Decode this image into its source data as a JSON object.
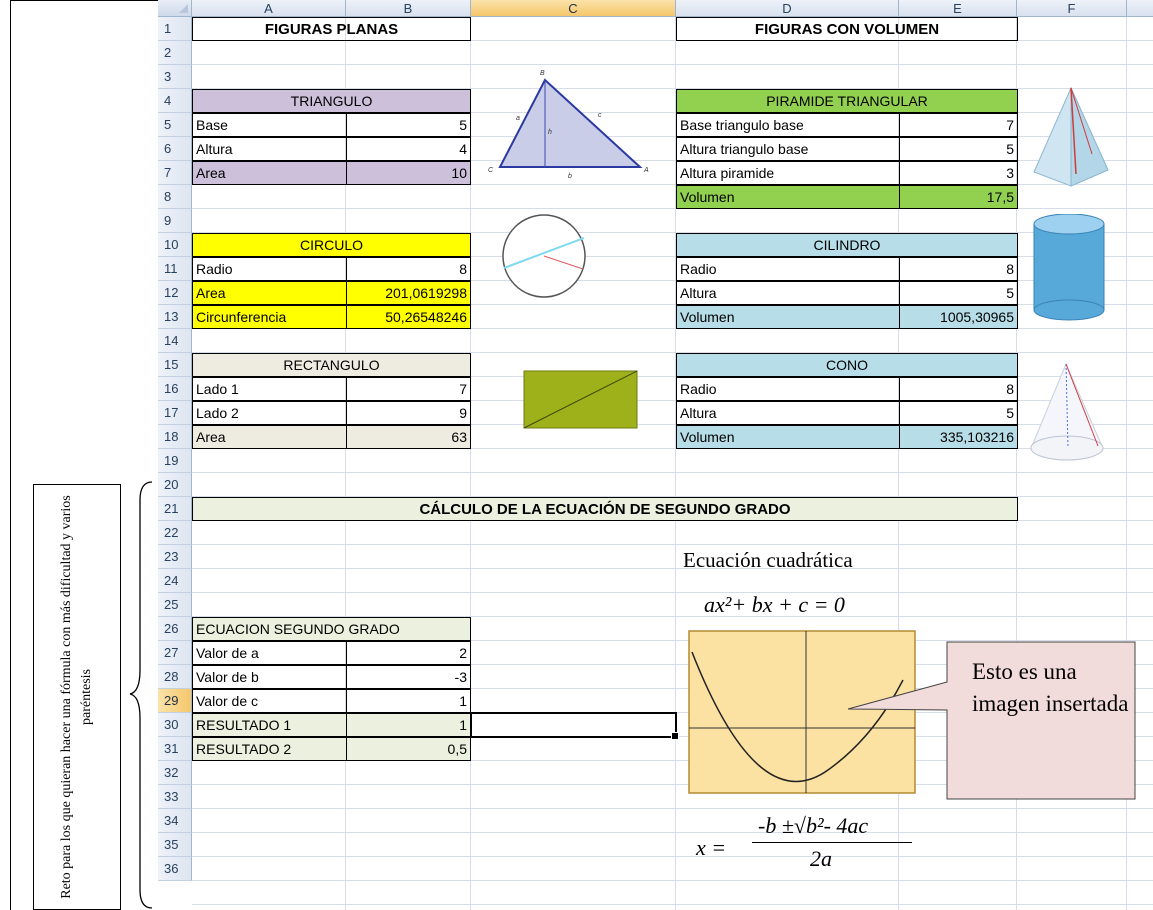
{
  "columns": [
    "A",
    "B",
    "C",
    "D",
    "E",
    "F"
  ],
  "rows": [
    "1",
    "2",
    "3",
    "4",
    "5",
    "6",
    "7",
    "8",
    "9",
    "10",
    "11",
    "12",
    "13",
    "14",
    "15",
    "16",
    "17",
    "18",
    "19",
    "20",
    "21",
    "22",
    "23",
    "24",
    "25",
    "26",
    "27",
    "28",
    "29",
    "30",
    "31",
    "32",
    "33",
    "34",
    "35",
    "36"
  ],
  "selected_column": "C",
  "selected_row": "29",
  "note": "Reto para los que quieran hacer una fórmula con más dificultad y varios paréntesis",
  "plane": {
    "title": "FIGURAS PLANAS",
    "triangle": {
      "header": "TRIANGULO",
      "base_label": "Base",
      "base": "5",
      "height_label": "Altura",
      "height": "4",
      "area_label": "Area",
      "area": "10"
    },
    "circle": {
      "header": "CIRCULO",
      "radius_label": "Radio",
      "radius": "8",
      "area_label": "Area",
      "area": "201,0619298",
      "circ_label": "Circunferencia",
      "circ": "50,26548246"
    },
    "rectangle": {
      "header": "RECTANGULO",
      "side1_label": "Lado 1",
      "side1": "7",
      "side2_label": "Lado 2",
      "side2": "9",
      "area_label": "Area",
      "area": "63"
    }
  },
  "volume": {
    "title": "FIGURAS CON VOLUMEN",
    "pyramid": {
      "header": "PIRAMIDE TRIANGULAR",
      "r1_label": "Base triangulo base",
      "r1": "7",
      "r2_label": "Altura triangulo base",
      "r2": "5",
      "r3_label": "Altura piramide",
      "r3": "3",
      "vol_label": "Volumen",
      "vol": "17,5"
    },
    "cylinder": {
      "header": "CILINDRO",
      "radius_label": "Radio",
      "radius": "8",
      "height_label": "Altura",
      "height": "5",
      "vol_label": "Volumen",
      "vol": "1005,30965"
    },
    "cone": {
      "header": "CONO",
      "radius_label": "Radio",
      "radius": "8",
      "height_label": "Altura",
      "height": "5",
      "vol_label": "Volumen",
      "vol": "335,103216"
    }
  },
  "quadratic": {
    "banner": "CÁLCULO DE LA ECUACIÓN DE SEGUNDO GRADO",
    "header": "ECUACION SEGUNDO GRADO",
    "a_label": "Valor de a",
    "a": "2",
    "b_label": "Valor de b",
    "b": "-3",
    "c_label": "Valor de c",
    "c": "1",
    "r1_label": "RESULTADO 1",
    "r1": "1",
    "r2_label": "RESULTADO 2",
    "r2": "0,5"
  },
  "image": {
    "title": "Ecuación cuadrática",
    "equation": "ax²+ bx + c = 0",
    "callout": "Esto es una imagen insertada",
    "solution_lhs": "x =",
    "solution_num": "-b ±√b²- 4ac",
    "solution_den": "2a"
  },
  "triangle_vertices": [
    "B",
    "C",
    "A"
  ],
  "triangle_sides": [
    "a",
    "c",
    "b",
    "h"
  ]
}
